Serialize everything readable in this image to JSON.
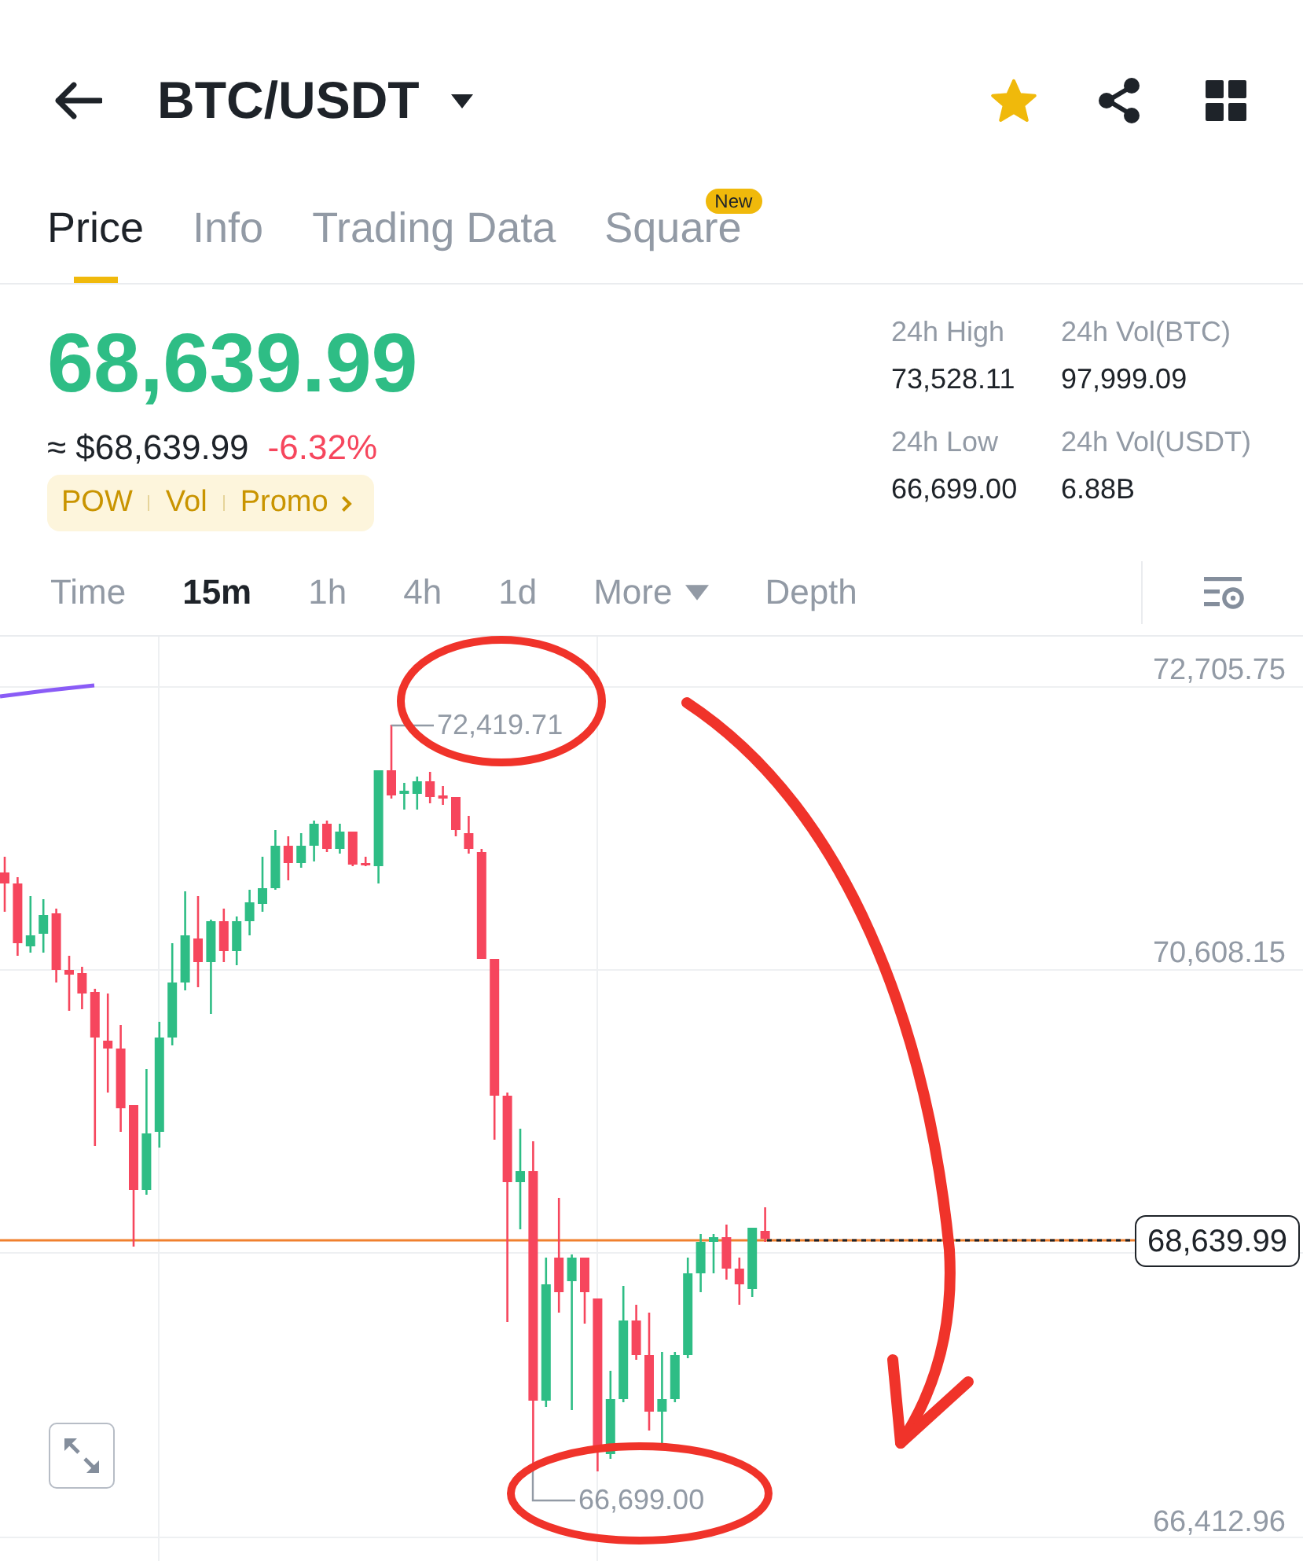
{
  "header": {
    "title": "BTC/USDT",
    "favorite": true
  },
  "tabs": [
    {
      "label": "Price",
      "selected": true
    },
    {
      "label": "Info",
      "selected": false
    },
    {
      "label": "Trading Data",
      "selected": false
    },
    {
      "label": "Square",
      "selected": false,
      "badge": "New"
    }
  ],
  "ticker": {
    "price": "68,639.99",
    "price_up": true,
    "fiat_price": "≈ $68,639.99",
    "change": "-6.32%",
    "change_up": false,
    "tags": [
      "POW",
      "Vol",
      "Promo"
    ]
  },
  "stats": [
    {
      "label": "24h High",
      "value": "73,528.11"
    },
    {
      "label": "24h Vol(BTC)",
      "value": "97,999.09"
    },
    {
      "label": "24h Low",
      "value": "66,699.00"
    },
    {
      "label": "24h Vol(USDT)",
      "value": "6.88B"
    }
  ],
  "intervals": [
    {
      "label": "Time",
      "kind": "option",
      "selected": false
    },
    {
      "label": "15m",
      "kind": "option",
      "selected": true
    },
    {
      "label": "1h",
      "kind": "option",
      "selected": false
    },
    {
      "label": "4h",
      "kind": "option",
      "selected": false
    },
    {
      "label": "1d",
      "kind": "option",
      "selected": false
    },
    {
      "label": "More",
      "kind": "dropdown",
      "selected": false
    },
    {
      "label": "Depth",
      "kind": "option",
      "selected": false
    }
  ],
  "chart": {
    "price_labels": [
      "72,705.75",
      "70,608.15",
      "66,412.96"
    ],
    "last_price": "68,639.99",
    "high_label": "72,419.71",
    "low_label": "66,699.00"
  }
}
